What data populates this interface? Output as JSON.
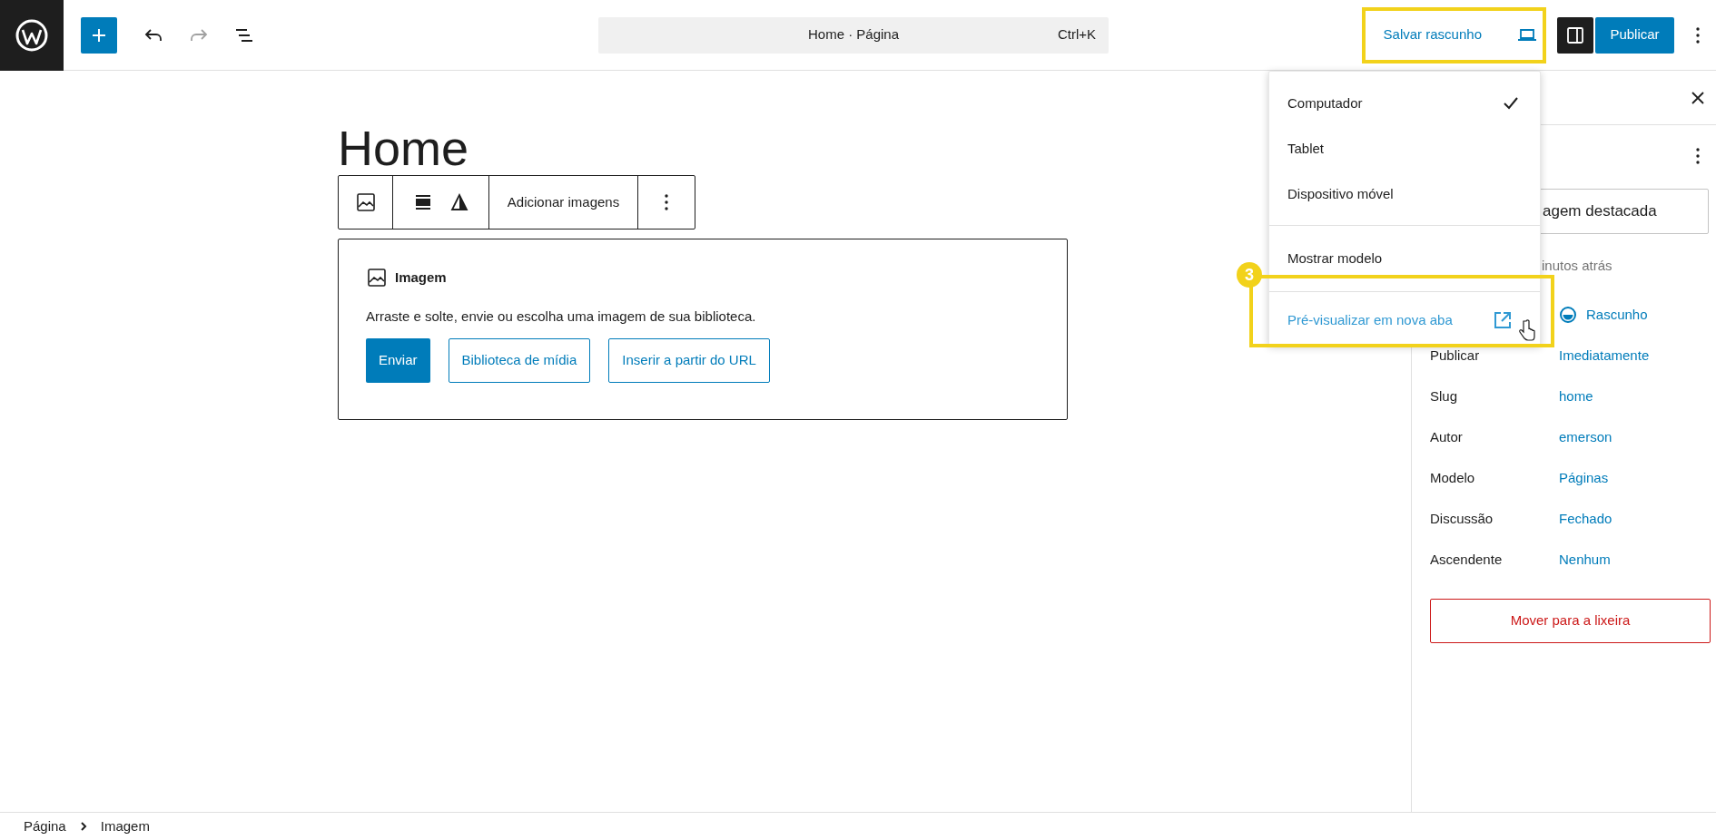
{
  "topbar": {
    "command_bar": {
      "title": "Home · Página",
      "shortcut": "Ctrl+K"
    },
    "save_draft": "Salvar rascunho",
    "publish": "Publicar"
  },
  "editor": {
    "title": "Home",
    "toolbar": {
      "label": "Adicionar imagens"
    },
    "image_block": {
      "heading": "Imagem",
      "instructions": "Arraste e solte, envie ou escolha uma imagem de sua biblioteca.",
      "buttons": [
        {
          "label": "Enviar",
          "kind": "primary"
        },
        {
          "label": "Biblioteca de mídia",
          "kind": "secondary"
        },
        {
          "label": "Inserir a partir do URL",
          "kind": "secondary"
        }
      ]
    }
  },
  "sidebar": {
    "featured_image": "agem destacada",
    "last_edited": "inutos atrás",
    "fields": [
      {
        "kind": "status",
        "value": "Rascunho"
      },
      {
        "kind": "field",
        "label": "Publicar",
        "value": "Imediatamente"
      },
      {
        "kind": "field",
        "label": "Slug",
        "value": "home"
      },
      {
        "kind": "field",
        "label": "Autor",
        "value": "emerson"
      },
      {
        "kind": "field",
        "label": "Modelo",
        "value": "Páginas"
      },
      {
        "kind": "field",
        "label": "Discussão",
        "value": "Fechado"
      },
      {
        "kind": "field",
        "label": "Ascendente",
        "value": "Nenhum"
      }
    ],
    "trash": "Mover para a lixeira"
  },
  "preview_menu": {
    "devices": [
      {
        "label": "Computador",
        "selected": true
      },
      {
        "label": "Tablet",
        "selected": false
      },
      {
        "label": "Dispositivo móvel",
        "selected": false
      }
    ],
    "show_template": "Mostrar modelo",
    "preview_new_tab": "Pré-visualizar em nova aba"
  },
  "annotation": {
    "step": "3"
  },
  "breadcrumb": [
    "Página",
    "Imagem"
  ]
}
